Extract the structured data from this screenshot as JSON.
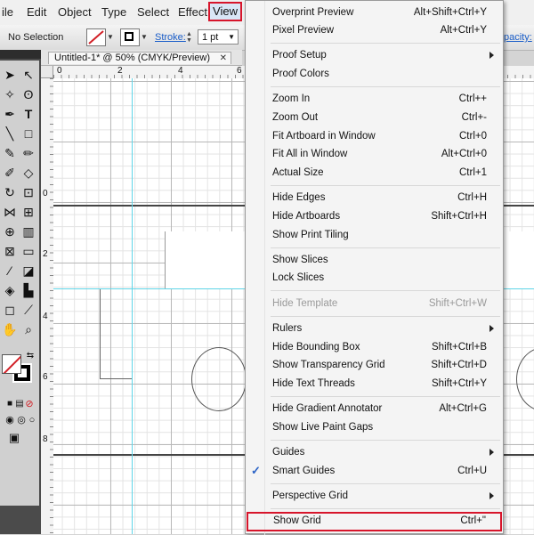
{
  "menubar": {
    "items": [
      "ile",
      "Edit",
      "Object",
      "Type",
      "Select",
      "Effect"
    ],
    "active": "View"
  },
  "control_bar": {
    "selection": "No Selection",
    "stroke_label": "Stroke:",
    "stroke_weight": "1 pt",
    "opacity_label": "pacity:"
  },
  "document": {
    "tab_title": "Untitled-1* @ 50% (CMYK/Preview)",
    "close": "✕"
  },
  "rulers": {
    "top": [
      "0",
      "2",
      "4",
      "6"
    ],
    "left": [
      "0",
      "2",
      "4",
      "6",
      "8"
    ]
  },
  "view_menu": {
    "items": [
      {
        "label": "Overprint Preview",
        "shortcut": "Alt+Shift+Ctrl+Y"
      },
      {
        "label": "Pixel Preview",
        "shortcut": "Alt+Ctrl+Y"
      },
      {
        "label": "Proof Setup",
        "shortcut": "",
        "submenu": true
      },
      {
        "label": "Proof Colors",
        "shortcut": ""
      },
      {
        "label": "Zoom In",
        "shortcut": "Ctrl++"
      },
      {
        "label": "Zoom Out",
        "shortcut": "Ctrl+-"
      },
      {
        "label": "Fit Artboard in Window",
        "shortcut": "Ctrl+0"
      },
      {
        "label": "Fit All in Window",
        "shortcut": "Alt+Ctrl+0"
      },
      {
        "label": "Actual Size",
        "shortcut": "Ctrl+1"
      },
      {
        "label": "Hide Edges",
        "shortcut": "Ctrl+H"
      },
      {
        "label": "Hide Artboards",
        "shortcut": "Shift+Ctrl+H"
      },
      {
        "label": "Show Print Tiling",
        "shortcut": ""
      },
      {
        "label": "Show Slices",
        "shortcut": ""
      },
      {
        "label": "Lock Slices",
        "shortcut": ""
      },
      {
        "label": "Hide Template",
        "shortcut": "Shift+Ctrl+W",
        "disabled": true
      },
      {
        "label": "Rulers",
        "shortcut": "",
        "submenu": true
      },
      {
        "label": "Hide Bounding Box",
        "shortcut": "Shift+Ctrl+B"
      },
      {
        "label": "Show Transparency Grid",
        "shortcut": "Shift+Ctrl+D"
      },
      {
        "label": "Hide Text Threads",
        "shortcut": "Shift+Ctrl+Y"
      },
      {
        "label": "Hide Gradient Annotator",
        "shortcut": "Alt+Ctrl+G"
      },
      {
        "label": "Show Live Paint Gaps",
        "shortcut": ""
      },
      {
        "label": "Guides",
        "shortcut": "",
        "submenu": true
      },
      {
        "label": "Smart Guides",
        "shortcut": "Ctrl+U",
        "checked": true
      },
      {
        "label": "Perspective Grid",
        "shortcut": "",
        "submenu": true
      },
      {
        "label": "Show Grid",
        "shortcut": "Ctrl+\"",
        "highlighted": true
      }
    ],
    "check_glyph": "✓"
  },
  "colors": {
    "highlight_border": "#d7152b",
    "guide": "#5fd5e8",
    "stroke_link": "#1b5ec9"
  }
}
